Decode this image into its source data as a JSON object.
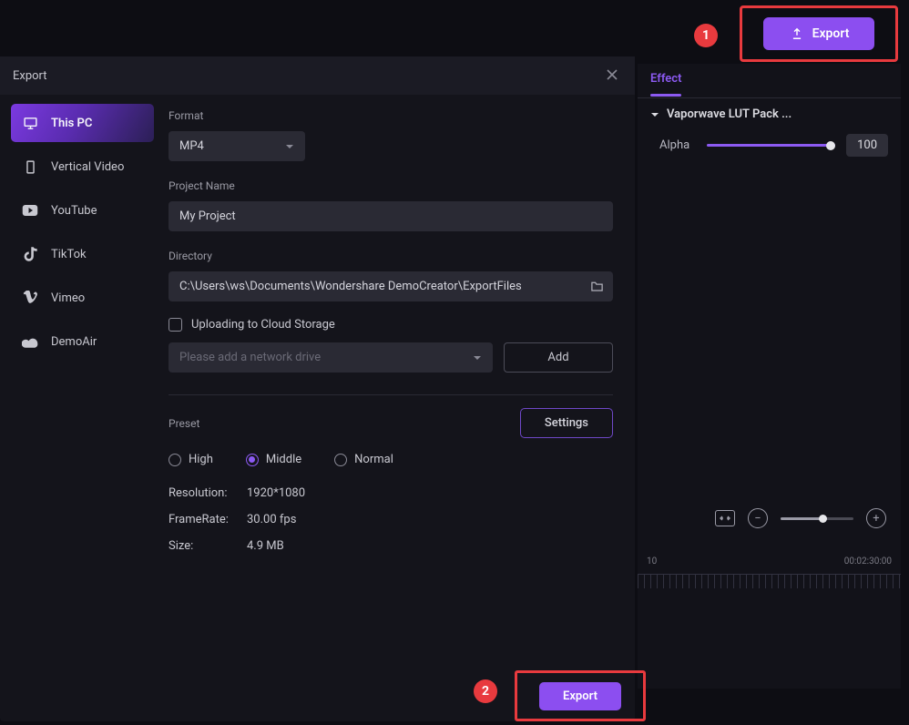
{
  "top": {
    "export_label": "Export",
    "callout_1": "1"
  },
  "effect_panel": {
    "tab_label": "Effect",
    "section_title": "Vaporwave LUT Pack ...",
    "alpha_label": "Alpha",
    "alpha_value": "100"
  },
  "timeline": {
    "ruler_left": "10",
    "ruler_right": "00:02:30:00"
  },
  "modal": {
    "title": "Export",
    "sidebar": {
      "this_pc": "This PC",
      "vertical_video": "Vertical Video",
      "youtube": "YouTube",
      "tiktok": "TikTok",
      "vimeo": "Vimeo",
      "demoair": "DemoAir"
    },
    "labels": {
      "format": "Format",
      "project_name": "Project Name",
      "directory": "Directory",
      "upload_cloud": "Uploading to Cloud Storage",
      "drive_placeholder": "Please add a network drive",
      "add": "Add",
      "preset": "Preset",
      "settings": "Settings"
    },
    "values": {
      "format": "MP4",
      "project_name": "My Project",
      "directory": "C:\\Users\\ws\\Documents\\Wondershare DemoCreator\\ExportFiles"
    },
    "preset_options": {
      "high": "High",
      "middle": "Middle",
      "normal": "Normal"
    },
    "specs": {
      "resolution_label": "Resolution:",
      "resolution_value": "1920*1080",
      "framerate_label": "FrameRate:",
      "framerate_value": "30.00 fps",
      "size_label": "Size:",
      "size_value": "4.9 MB"
    },
    "bottom_export_label": "Export",
    "callout_2": "2"
  }
}
